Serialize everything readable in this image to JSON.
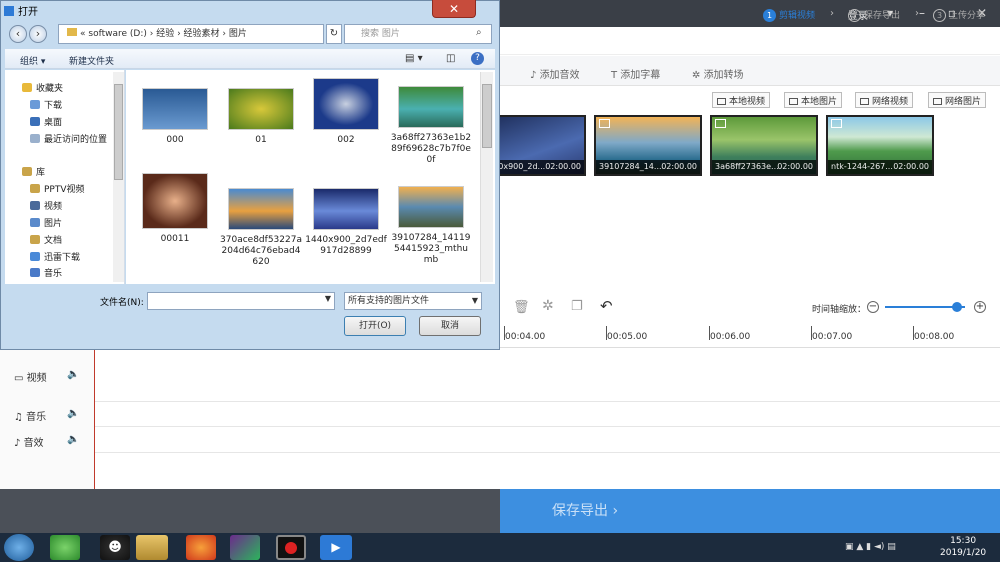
{
  "app": {
    "login": "登录",
    "steps": [
      {
        "num": "1",
        "label": "剪辑视频"
      },
      {
        "num": "2",
        "label": "保存导出"
      },
      {
        "num": "3",
        "label": "上传分享"
      }
    ],
    "tabs": [
      "添加音效",
      "添加字幕",
      "添加转场"
    ],
    "source_buttons": [
      "本地视频",
      "本地图片",
      "网络视频",
      "网络图片"
    ],
    "media": [
      {
        "name": "1440x900_2d...",
        "duration": "02:00.00"
      },
      {
        "name": "39107284_14...",
        "duration": "02:00.00"
      },
      {
        "name": "3a68ff27363e...",
        "duration": "02:00.00"
      },
      {
        "name": "ntk-1244-267...",
        "duration": "02:00.00"
      }
    ],
    "zoom_label": "时间轴缩放：",
    "zoom_level": 0.9,
    "ruler": [
      "00:04.00",
      "00:05.00",
      "00:06.00",
      "00:07.00",
      "00:08.00"
    ],
    "tracks": [
      "视频",
      "音乐",
      "音效"
    ],
    "export_label": "保存导出",
    "clock_time": "15:30",
    "clock_date": "2019/1/20"
  },
  "dialog": {
    "title": "打开",
    "path": [
      "software (D:)",
      "经验",
      "经验素材",
      "图片"
    ],
    "search_placeholder": "搜索 图片",
    "organize": "组织",
    "new_folder": "新建文件夹",
    "nav_favorites": "收藏夹",
    "nav_fav_items": [
      "下载",
      "桌面",
      "最近访问的位置"
    ],
    "nav_library": "库",
    "nav_lib_items": [
      "PPTV视频",
      "视频",
      "图片",
      "文档",
      "迅雷下载",
      "音乐"
    ],
    "files": [
      {
        "name": "000",
        "color": "#3c6ea6"
      },
      {
        "name": "01",
        "color": "#7a9a2c"
      },
      {
        "name": "002",
        "color": "#2a4fa0"
      },
      {
        "name": "3a68ff27363e1b289f69628c7b7f0e0f",
        "color": "#2e8a6a"
      },
      {
        "name": "00011",
        "color": "#8a4a38"
      },
      {
        "name": "370ace8df53227a204d64c76ebad4620",
        "color": "#c07a30"
      },
      {
        "name": "1440x900_2d7edf917d28899",
        "color": "#3a4c9a"
      },
      {
        "name": "39107284_1411954415923_mthumb",
        "color": "#4c7aa0"
      }
    ],
    "filename_label": "文件名(N):",
    "filetype": "所有支持的图片文件",
    "open_btn": "打开(O)",
    "cancel_btn": "取消"
  }
}
